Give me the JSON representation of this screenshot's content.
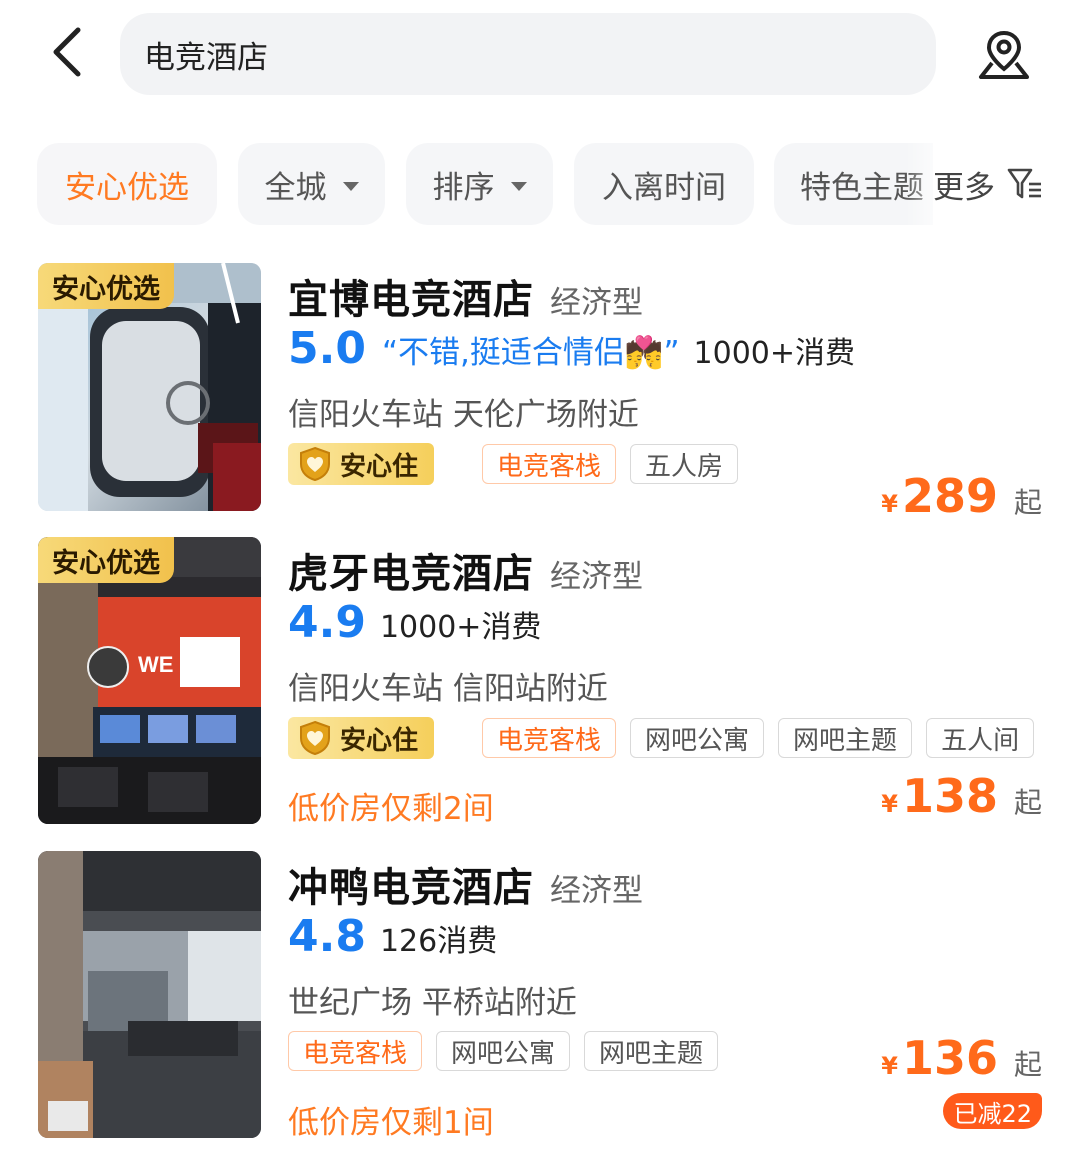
{
  "search": {
    "query": "电竞酒店"
  },
  "filters": [
    {
      "label": "安心优选",
      "active": true
    },
    {
      "label": "全城",
      "dropdown": true
    },
    {
      "label": "排序",
      "dropdown": true
    },
    {
      "label": "入离时间"
    },
    {
      "label": "特色主题"
    }
  ],
  "more_label": "更多",
  "badge_top_label": "安心优选",
  "anxin_label": "安心住",
  "hotels": [
    {
      "name": "宜博电竞酒店",
      "type": "经济型",
      "score": "5.0",
      "review": "“不错,挺适合情侣💏”",
      "consume": "1000+消费",
      "location": "信阳火车站 天伦广场附近",
      "tags": [
        "电竞客栈",
        "五人房"
      ],
      "currency": "¥",
      "price": "289",
      "price_suffix": "起"
    },
    {
      "name": "虎牙电竞酒店",
      "type": "经济型",
      "score": "4.9",
      "consume": "1000+消费",
      "location": "信阳火车站 信阳站附近",
      "tags": [
        "电竞客栈",
        "网吧公寓",
        "网吧主题",
        "五人间"
      ],
      "low_stock": "低价房仅剩2间",
      "currency": "¥",
      "price": "138",
      "price_suffix": "起"
    },
    {
      "name": "冲鸭电竞酒店",
      "type": "经济型",
      "score": "4.8",
      "consume": "126消费",
      "location": "世纪广场 平桥站附近",
      "tags": [
        "电竞客栈",
        "网吧公寓",
        "网吧主题"
      ],
      "low_stock": "低价房仅剩1间",
      "currency": "¥",
      "price": "136",
      "price_suffix": "起",
      "discount": "已减22"
    }
  ],
  "colors": {
    "accent_orange": "#ff7a22",
    "rating_blue": "#1a7cf0",
    "price_orange": "#ff6a1a",
    "badge_gold": "#f1c14c"
  }
}
